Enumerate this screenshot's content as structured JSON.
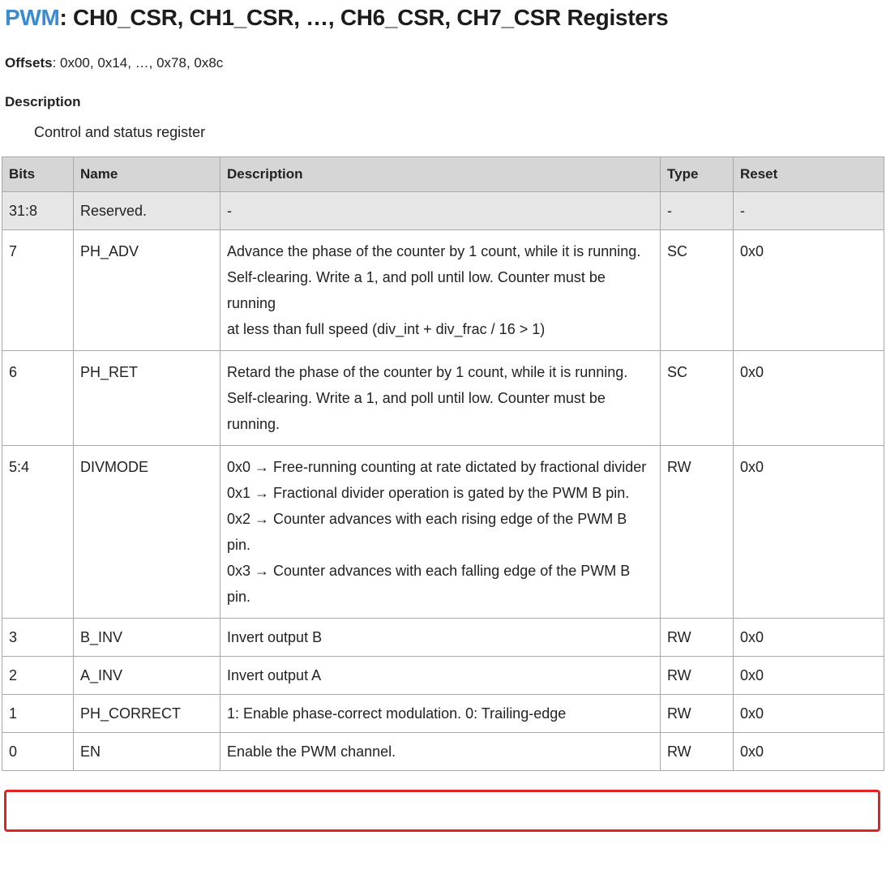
{
  "header": {
    "peripheral": "PWM",
    "title_rest": ": CH0_CSR, CH1_CSR, …, CH6_CSR, CH7_CSR Registers"
  },
  "offsets": {
    "label": "Offsets",
    "value": ": 0x00, 0x14, …, 0x78, 0x8c"
  },
  "description": {
    "heading": "Description",
    "text": "Control and status register"
  },
  "table": {
    "columns": [
      "Bits",
      "Name",
      "Description",
      "Type",
      "Reset"
    ],
    "rows": [
      {
        "bits": "31:8",
        "name": "Reserved.",
        "description": [
          "-"
        ],
        "type": "-",
        "reset": "-"
      },
      {
        "bits": "7",
        "name": "PH_ADV",
        "description": [
          "Advance the phase of the counter by 1 count, while it is running.",
          "Self-clearing. Write a 1, and poll until low. Counter must be running",
          "at less than full speed (div_int + div_frac / 16 > 1)"
        ],
        "type": "SC",
        "reset": "0x0"
      },
      {
        "bits": "6",
        "name": "PH_RET",
        "description": [
          "Retard the phase of the counter by 1 count, while it is running.",
          "Self-clearing. Write a 1, and poll until low. Counter must be running."
        ],
        "type": "SC",
        "reset": "0x0"
      },
      {
        "bits": "5:4",
        "name": "DIVMODE",
        "description": [
          "0x0 → Free-running counting at rate dictated by fractional divider",
          "0x1 → Fractional divider operation is gated by the PWM B pin.",
          "0x2 → Counter advances with each rising edge of the PWM B pin.",
          "0x3 → Counter advances with each falling edge of the PWM B pin."
        ],
        "type": "RW",
        "reset": "0x0"
      },
      {
        "bits": "3",
        "name": "B_INV",
        "description": [
          "Invert output B"
        ],
        "type": "RW",
        "reset": "0x0"
      },
      {
        "bits": "2",
        "name": "A_INV",
        "description": [
          "Invert output A"
        ],
        "type": "RW",
        "reset": "0x0"
      },
      {
        "bits": "1",
        "name": "PH_CORRECT",
        "description": [
          "1: Enable phase-correct modulation. 0: Trailing-edge"
        ],
        "type": "RW",
        "reset": "0x0"
      },
      {
        "bits": "0",
        "name": "EN",
        "description": [
          "Enable the PWM channel."
        ],
        "type": "RW",
        "reset": "0x0"
      }
    ]
  },
  "highlight": {
    "row": "PH_CORRECT",
    "color": "#e02424"
  }
}
